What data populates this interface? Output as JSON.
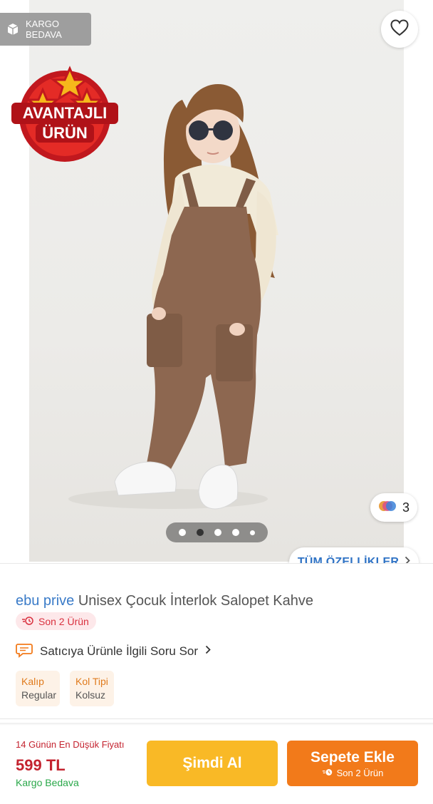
{
  "gallery": {
    "cargo_badge": "KARGO BEDAVA",
    "advantage_badge": {
      "line1": "AVANTAJLI",
      "line2": "ÜRÜN"
    },
    "color_count": "3",
    "slide_count_shown": 5,
    "active_slide_index": 1,
    "all_features_label": "TÜM ÖZELLİKLER"
  },
  "product": {
    "brand": "ebu prive",
    "name": "Unisex Çocuk İnterlok Salopet Kahve",
    "stock_badge": "Son 2 Ürün",
    "ask_seller_label": "Satıcıya Ürünle İlgili Soru Sor",
    "attributes": [
      {
        "key": "Kalıp",
        "value": "Regular"
      },
      {
        "key": "Kol Tipi",
        "value": "Kolsuz"
      }
    ]
  },
  "purchase_bar": {
    "lowest_price_label": "14 Günün En Düşük Fiyatı",
    "price": "599 TL",
    "shipping": "Kargo Bedava",
    "buy_now_label": "Şimdi Al",
    "add_to_cart_label": "Sepete Ekle",
    "add_to_cart_sub": "Son 2 Ürün"
  },
  "colors": {
    "brand_blue": "#3a7bc8",
    "orange": "#f27a1a",
    "yellow": "#f9b926",
    "price_red": "#c4232f",
    "green": "#2aa84a"
  },
  "icons": [
    "box-icon",
    "heart-icon",
    "color-swatch-icon",
    "chevron-right-icon",
    "clock-icon",
    "chat-bubble-icon"
  ]
}
